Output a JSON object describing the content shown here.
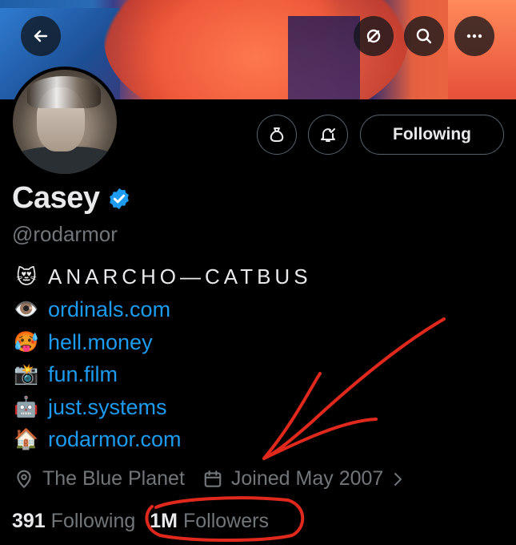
{
  "header": {
    "back_icon": "arrow-left-icon",
    "hide_icon": "eye-slash-icon",
    "search_icon": "search-icon",
    "more_icon": "ellipsis-icon"
  },
  "profile": {
    "name": "Casey",
    "handle": "@rodarmor",
    "verified": true,
    "accent_color": "#1d9bf0"
  },
  "actions": {
    "tip_icon": "money-bag-icon",
    "notify_icon": "bell-check-icon",
    "following_label": "Following"
  },
  "bio": [
    {
      "emoji": "😻",
      "text": "ANARCHO—CATBUS",
      "is_link": false
    },
    {
      "emoji": "👁️",
      "text": "ordinals.com",
      "is_link": true
    },
    {
      "emoji": "🥵",
      "text": "hell.money",
      "is_link": true
    },
    {
      "emoji": "📸",
      "text": "fun.film",
      "is_link": true
    },
    {
      "emoji": "🤖",
      "text": "just.systems",
      "is_link": true
    },
    {
      "emoji": "🏠",
      "text": "rodarmor.com",
      "is_link": true
    }
  ],
  "meta": {
    "location": "The Blue Planet",
    "joined": "Joined May 2007"
  },
  "stats": {
    "following_count": "391",
    "following_label": "Following",
    "followers_count": "1M",
    "followers_label": "Followers"
  },
  "annotation_color": "#e0281c"
}
